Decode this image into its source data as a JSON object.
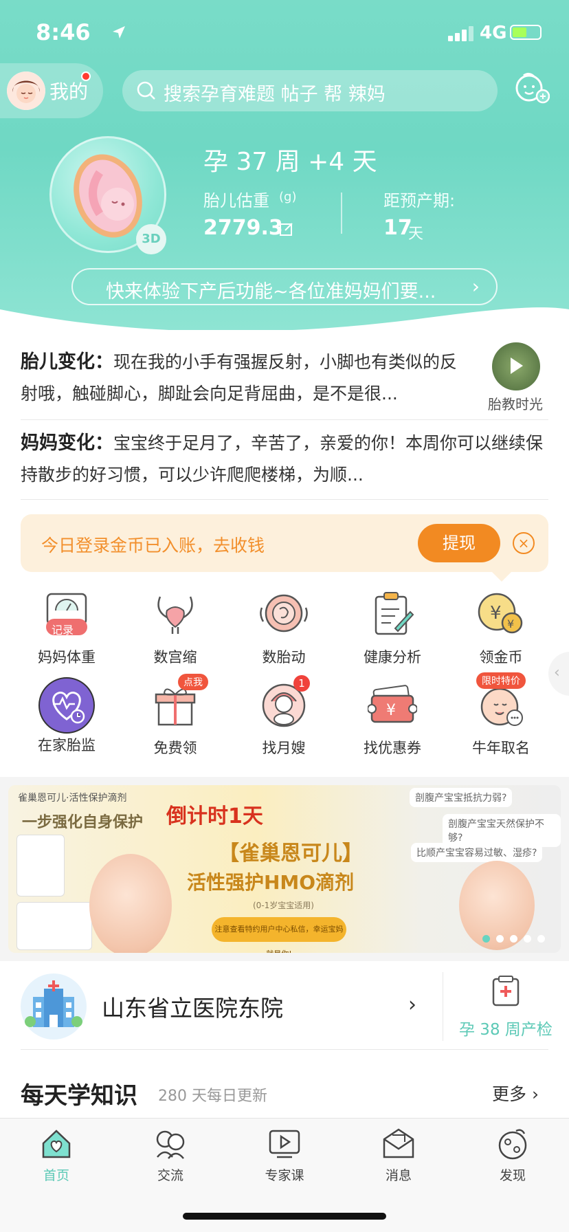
{
  "status_bar": {
    "time": "8:46",
    "network": "4G"
  },
  "header": {
    "me_label": "我的",
    "search_placeholder": "搜索孕育难题 帖子 帮 辣妈"
  },
  "pregnancy": {
    "week_text": "孕 37 周 +4 天",
    "badge_3d": "3D",
    "weight_label": "胎儿估重",
    "weight_unit": "(g)",
    "weight_value": "2779.3",
    "due_label": "距预产期:",
    "due_value": "17",
    "due_unit": "天",
    "notice": "快来体验下产后功能~各位准妈妈们要..."
  },
  "changes": {
    "baby_title": "胎儿变化",
    "baby_text": "现在我的小手有强握反射，小脚也有类似的反射哦，触碰脚心，脚趾会向足背屈曲，是不是很...",
    "music_label": "胎教时光",
    "mom_title": "妈妈变化",
    "mom_text": "宝宝终于足月了，辛苦了，亲爱的你！本周你可以继续保持散步的好习惯，可以少许爬爬楼梯，为顺..."
  },
  "coin_banner": {
    "text": "今日登录金币已入账，去收钱",
    "button": "提现",
    "close": "×"
  },
  "tools": [
    {
      "label": "妈妈体重",
      "icon": "scale-icon",
      "tag": "记录"
    },
    {
      "label": "数宫缩",
      "icon": "uterus-icon"
    },
    {
      "label": "数胎动",
      "icon": "fetal-movement-icon"
    },
    {
      "label": "健康分析",
      "icon": "clipboard-icon"
    },
    {
      "label": "领金币",
      "icon": "gold-coin-icon"
    },
    {
      "label": "在家胎监",
      "icon": "heart-monitor-icon"
    },
    {
      "label": "免费领",
      "icon": "gift-icon",
      "badge": "点我"
    },
    {
      "label": "找月嫂",
      "icon": "nanny-icon",
      "badge": "1"
    },
    {
      "label": "找优惠券",
      "icon": "coupon-icon"
    },
    {
      "label": "牛年取名",
      "icon": "baby-name-icon",
      "badge": "限时特价"
    }
  ],
  "ad": {
    "brand": "雀巢恩可儿·活性保护滴剂",
    "slogan": "一步强化自身保护",
    "countdown": "倒计时1天",
    "title1": "【雀巢恩可儿】",
    "title2": "活性强护HMO滴剂",
    "age": "(0-1岁宝宝适用)",
    "button": "注意查看特约用户中心私信，幸运宝妈就是你!",
    "q1": "剖腹产宝宝抵抗力弱?",
    "q2": "剖腹产宝宝天然保护不够?",
    "q3": "比顺产宝宝容易过敏、湿疹?"
  },
  "hospital": {
    "name": "山东省立医院东院",
    "checkup": "孕 38 周产检"
  },
  "learn": {
    "title": "每天学知识",
    "subtitle": "280 天每日更新",
    "more": "更多"
  },
  "tabbar": [
    {
      "label": "首页",
      "icon": "home-heart-icon",
      "active": true
    },
    {
      "label": "交流",
      "icon": "community-icon"
    },
    {
      "label": "专家课",
      "icon": "video-course-icon"
    },
    {
      "label": "消息",
      "icon": "message-icon"
    },
    {
      "label": "发现",
      "icon": "discover-icon"
    }
  ],
  "colors": {
    "primary": "#6fd8c4",
    "accent_orange": "#f28a22",
    "badge_red": "#f0423b"
  }
}
